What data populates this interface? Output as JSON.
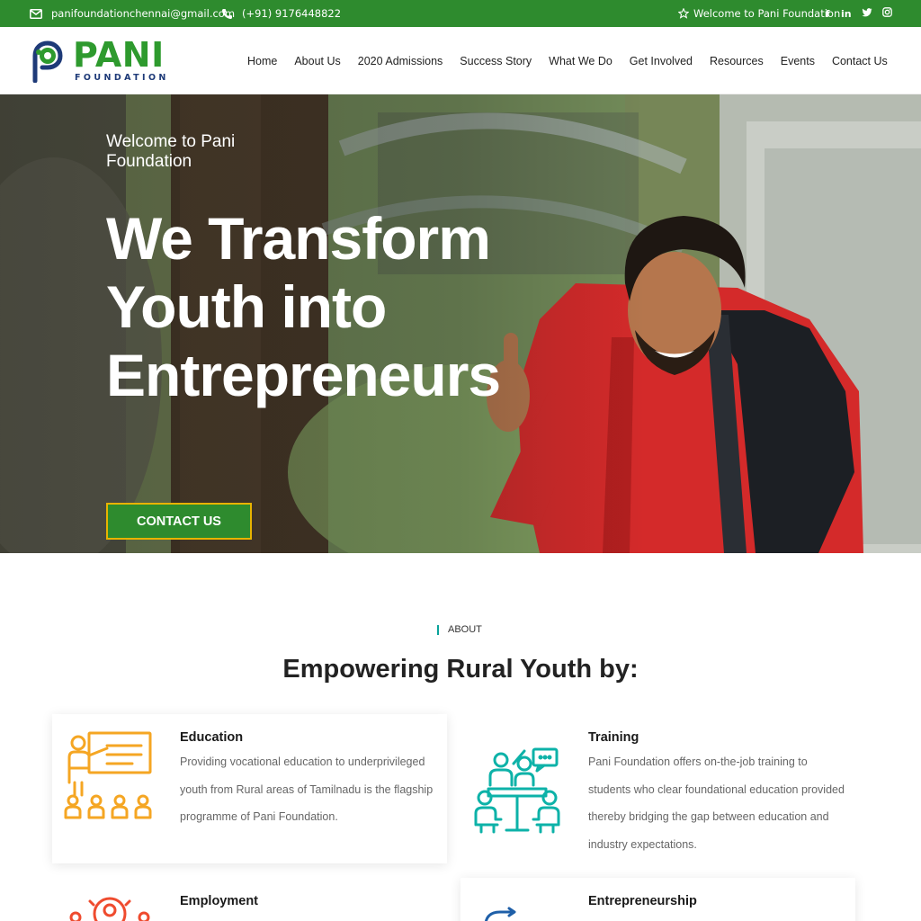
{
  "topbar": {
    "email": "panifoundationchennai@gmail.com",
    "phone": "(+91) 9176448822",
    "welcome": "Welcome to Pani Foundation",
    "social": [
      "facebook-icon",
      "linkedin-icon",
      "twitter-icon",
      "instagram-icon"
    ],
    "background": "#2e8b2e"
  },
  "logo": {
    "name": "PANI",
    "sub": "FOUNDATION"
  },
  "nav": {
    "items": [
      "Home",
      "About Us",
      "2020 Admissions",
      "Success Story",
      "What We Do",
      "Get Involved",
      "Resources",
      "Events",
      "Contact Us"
    ]
  },
  "hero": {
    "welcome": "Welcome to Pani Foundation",
    "title": "We Transform Youth into Entrepreneurs",
    "button": "CONTACT US",
    "button_color": "#2e8b2e",
    "button_border": "#e8b300"
  },
  "about": {
    "label": "ABOUT",
    "title": "Empowering Rural Youth by:",
    "cards": [
      {
        "title": "Education",
        "text": "Providing vocational education to underprivileged youth from Rural areas of Tamilnadu is the flagship programme of Pani Foundation.",
        "icon": "teacher-classroom-icon",
        "icon_color": "#f5a623"
      },
      {
        "title": "Training",
        "text": "Pani Foundation offers on-the-job training to students who clear foundational education provided thereby bridging the gap between education and industry expectations.",
        "icon": "team-meeting-icon",
        "icon_color": "#0db2a8"
      },
      {
        "title": "Employment",
        "text": "",
        "icon": "people-network-icon",
        "icon_color": "#ef4b2e"
      },
      {
        "title": "Entrepreneurship",
        "text": "",
        "icon": "growth-icon",
        "icon_color": "#1e5fa8"
      }
    ]
  }
}
